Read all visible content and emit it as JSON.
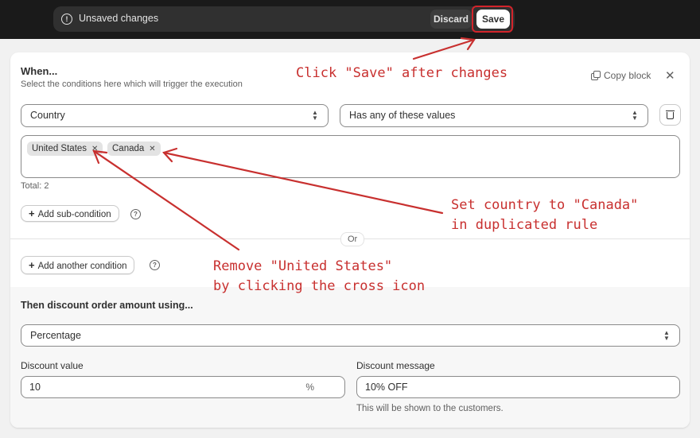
{
  "topbar": {
    "unsaved_text": "Unsaved changes",
    "discard_label": "Discard",
    "save_label": "Save"
  },
  "condition_block": {
    "title": "When...",
    "description": "Select the conditions here which will trigger the execution",
    "copy_block_label": "Copy block",
    "field_select": "Country",
    "operator_select": "Has any of these values",
    "tags": [
      "United States",
      "Canada"
    ],
    "total_text": "Total: 2",
    "add_sub_condition_label": "Add sub-condition",
    "or_label": "Or",
    "add_another_condition_label": "Add another condition"
  },
  "discount": {
    "title": "Then discount order amount using...",
    "method_select": "Percentage",
    "value_label": "Discount value",
    "value": "10",
    "value_suffix": "%",
    "message_label": "Discount message",
    "message_value": "10% OFF",
    "message_help": "This will be shown to the customers."
  },
  "annotations": {
    "save_note": "Click \"Save\" after changes",
    "country_note_line1": "Set country to \"Canada\"",
    "country_note_line2": "in duplicated rule",
    "remove_note_line1": "Remove \"United States\"",
    "remove_note_line2": "by clicking the cross icon"
  },
  "colors": {
    "annotation_red": "#c8302f",
    "topbar_bg": "#1a1a1a",
    "page_bg": "#f1f1f1"
  }
}
